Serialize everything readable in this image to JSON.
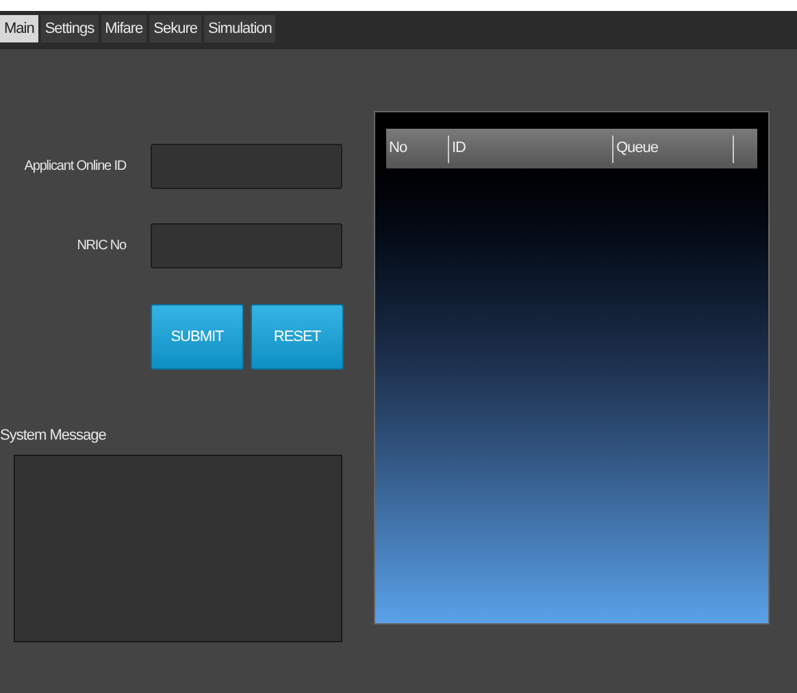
{
  "tabs": [
    {
      "label": "Main",
      "selected": true
    },
    {
      "label": "Settings",
      "selected": false
    },
    {
      "label": "Mifare",
      "selected": false
    },
    {
      "label": "Sekure",
      "selected": false
    },
    {
      "label": "Simulation",
      "selected": false
    }
  ],
  "form": {
    "fields": [
      {
        "label": "Applicant Online ID"
      },
      {
        "label": "NRIC No"
      }
    ],
    "buttons": [
      "SUBMIT",
      "RESET"
    ]
  },
  "system_message": {
    "label": "System Message"
  },
  "queue_table": {
    "columns": [
      "No",
      "ID",
      "Queue"
    ]
  }
}
